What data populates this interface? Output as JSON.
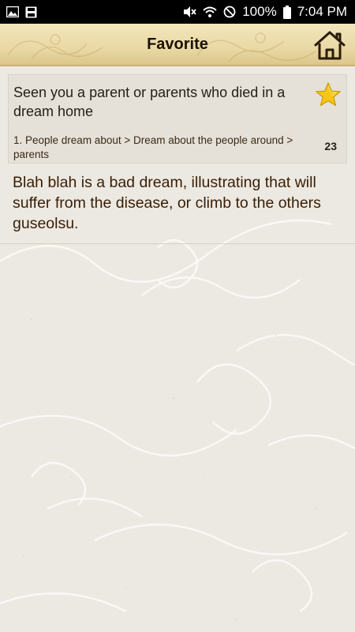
{
  "status_bar": {
    "battery_percent": "100%",
    "time": "7:04 PM",
    "icons": [
      "gallery-icon",
      "save-icon",
      "mute-icon",
      "wifi-icon",
      "no-disturb-icon",
      "battery-icon"
    ]
  },
  "header": {
    "title": "Favorite",
    "home_icon": "home-icon"
  },
  "favorites": [
    {
      "title": "Seen you a parent or parents who died in a dream home",
      "path": "1. People dream about > Dream about the people around > parents",
      "count": "23",
      "starred": true,
      "interpretation": "Blah blah is a bad dream, illustrating that will suffer from the disease, or climb to the others guseolsu."
    }
  ],
  "colors": {
    "header_gold": "#ead9a5",
    "star_yellow": "#f5c518",
    "text_brown": "#3a1e05",
    "background": "#ece9e2"
  }
}
